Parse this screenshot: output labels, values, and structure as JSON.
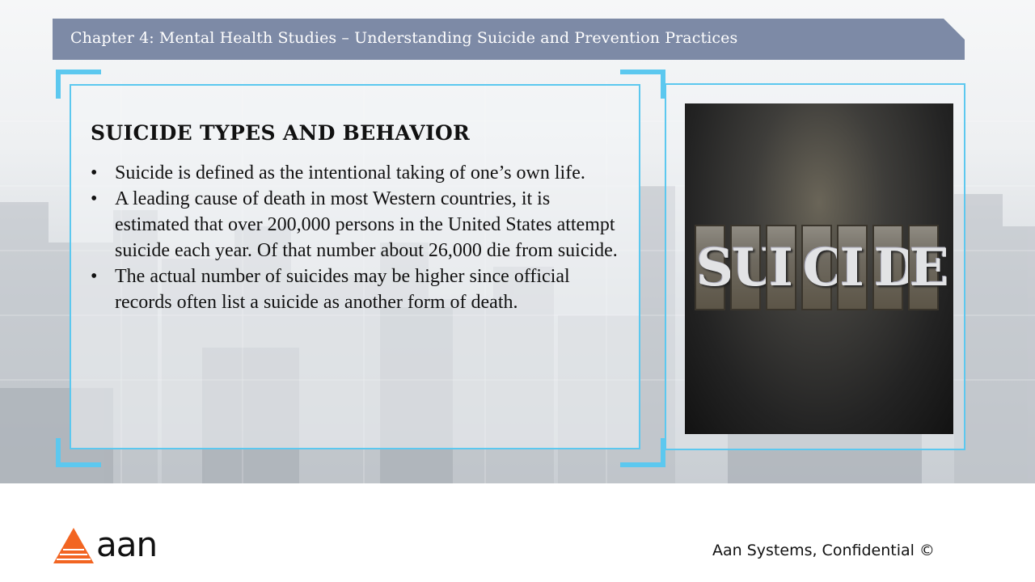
{
  "header": {
    "title": "Chapter 4: Mental Health Studies – Understanding Suicide and Prevention Practices"
  },
  "main": {
    "heading": "SUICIDE TYPES AND BEHAVIOR",
    "bullet_symbol": "•",
    "bullets": [
      "Suicide is defined as the intentional taking of one’s own life.",
      "A leading cause of death in most Western countries, it is estimated that over 200,000 persons in the United States attempt suicide each year.  Of that number about 26,000 die from suicide.",
      "The actual number of suicides may be higher since official records often list a suicide as another form of death."
    ]
  },
  "image": {
    "letters": [
      "S",
      "U",
      "I",
      "C",
      "I",
      "D",
      "E"
    ]
  },
  "footer": {
    "logo_text": "aan",
    "confidential": "Aan Systems, Confidential ©"
  },
  "colors": {
    "header_bg": "#7d8aa6",
    "accent": "#5cc8ef",
    "logo_orange": "#f26522"
  }
}
